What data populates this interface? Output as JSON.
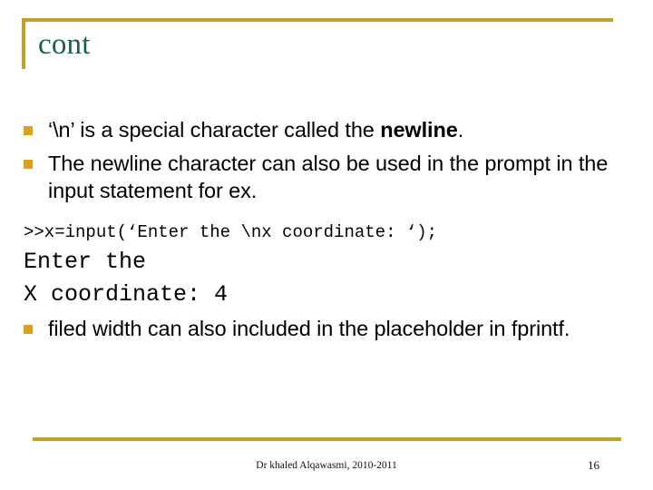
{
  "slide": {
    "title": "cont",
    "accent_gold": "#bfa22a",
    "bullet_gold": "#d9a21b",
    "title_green": "#1a6046",
    "body_text_color": "#000000"
  },
  "bullets": [
    {
      "marker": "square-bullet",
      "text_before": "‘\\n’ is a special character called the ",
      "text_bold": "newline",
      "text_after": "."
    },
    {
      "marker": "square-bullet",
      "text": "The newline character can also be used in the prompt in the input statement for ex."
    },
    {
      "marker": "square-bullet",
      "text": "filed width can also included in the placeholder in fprintf."
    }
  ],
  "code": {
    "command": ">>x=input(‘Enter the \\nx coordinate: ‘);",
    "output_line_1": "Enter the",
    "output_line_2": "X coordinate: 4"
  },
  "footer": {
    "credit": "Dr khaled Alqawasmi, 2010-2011",
    "page_number": "16"
  }
}
